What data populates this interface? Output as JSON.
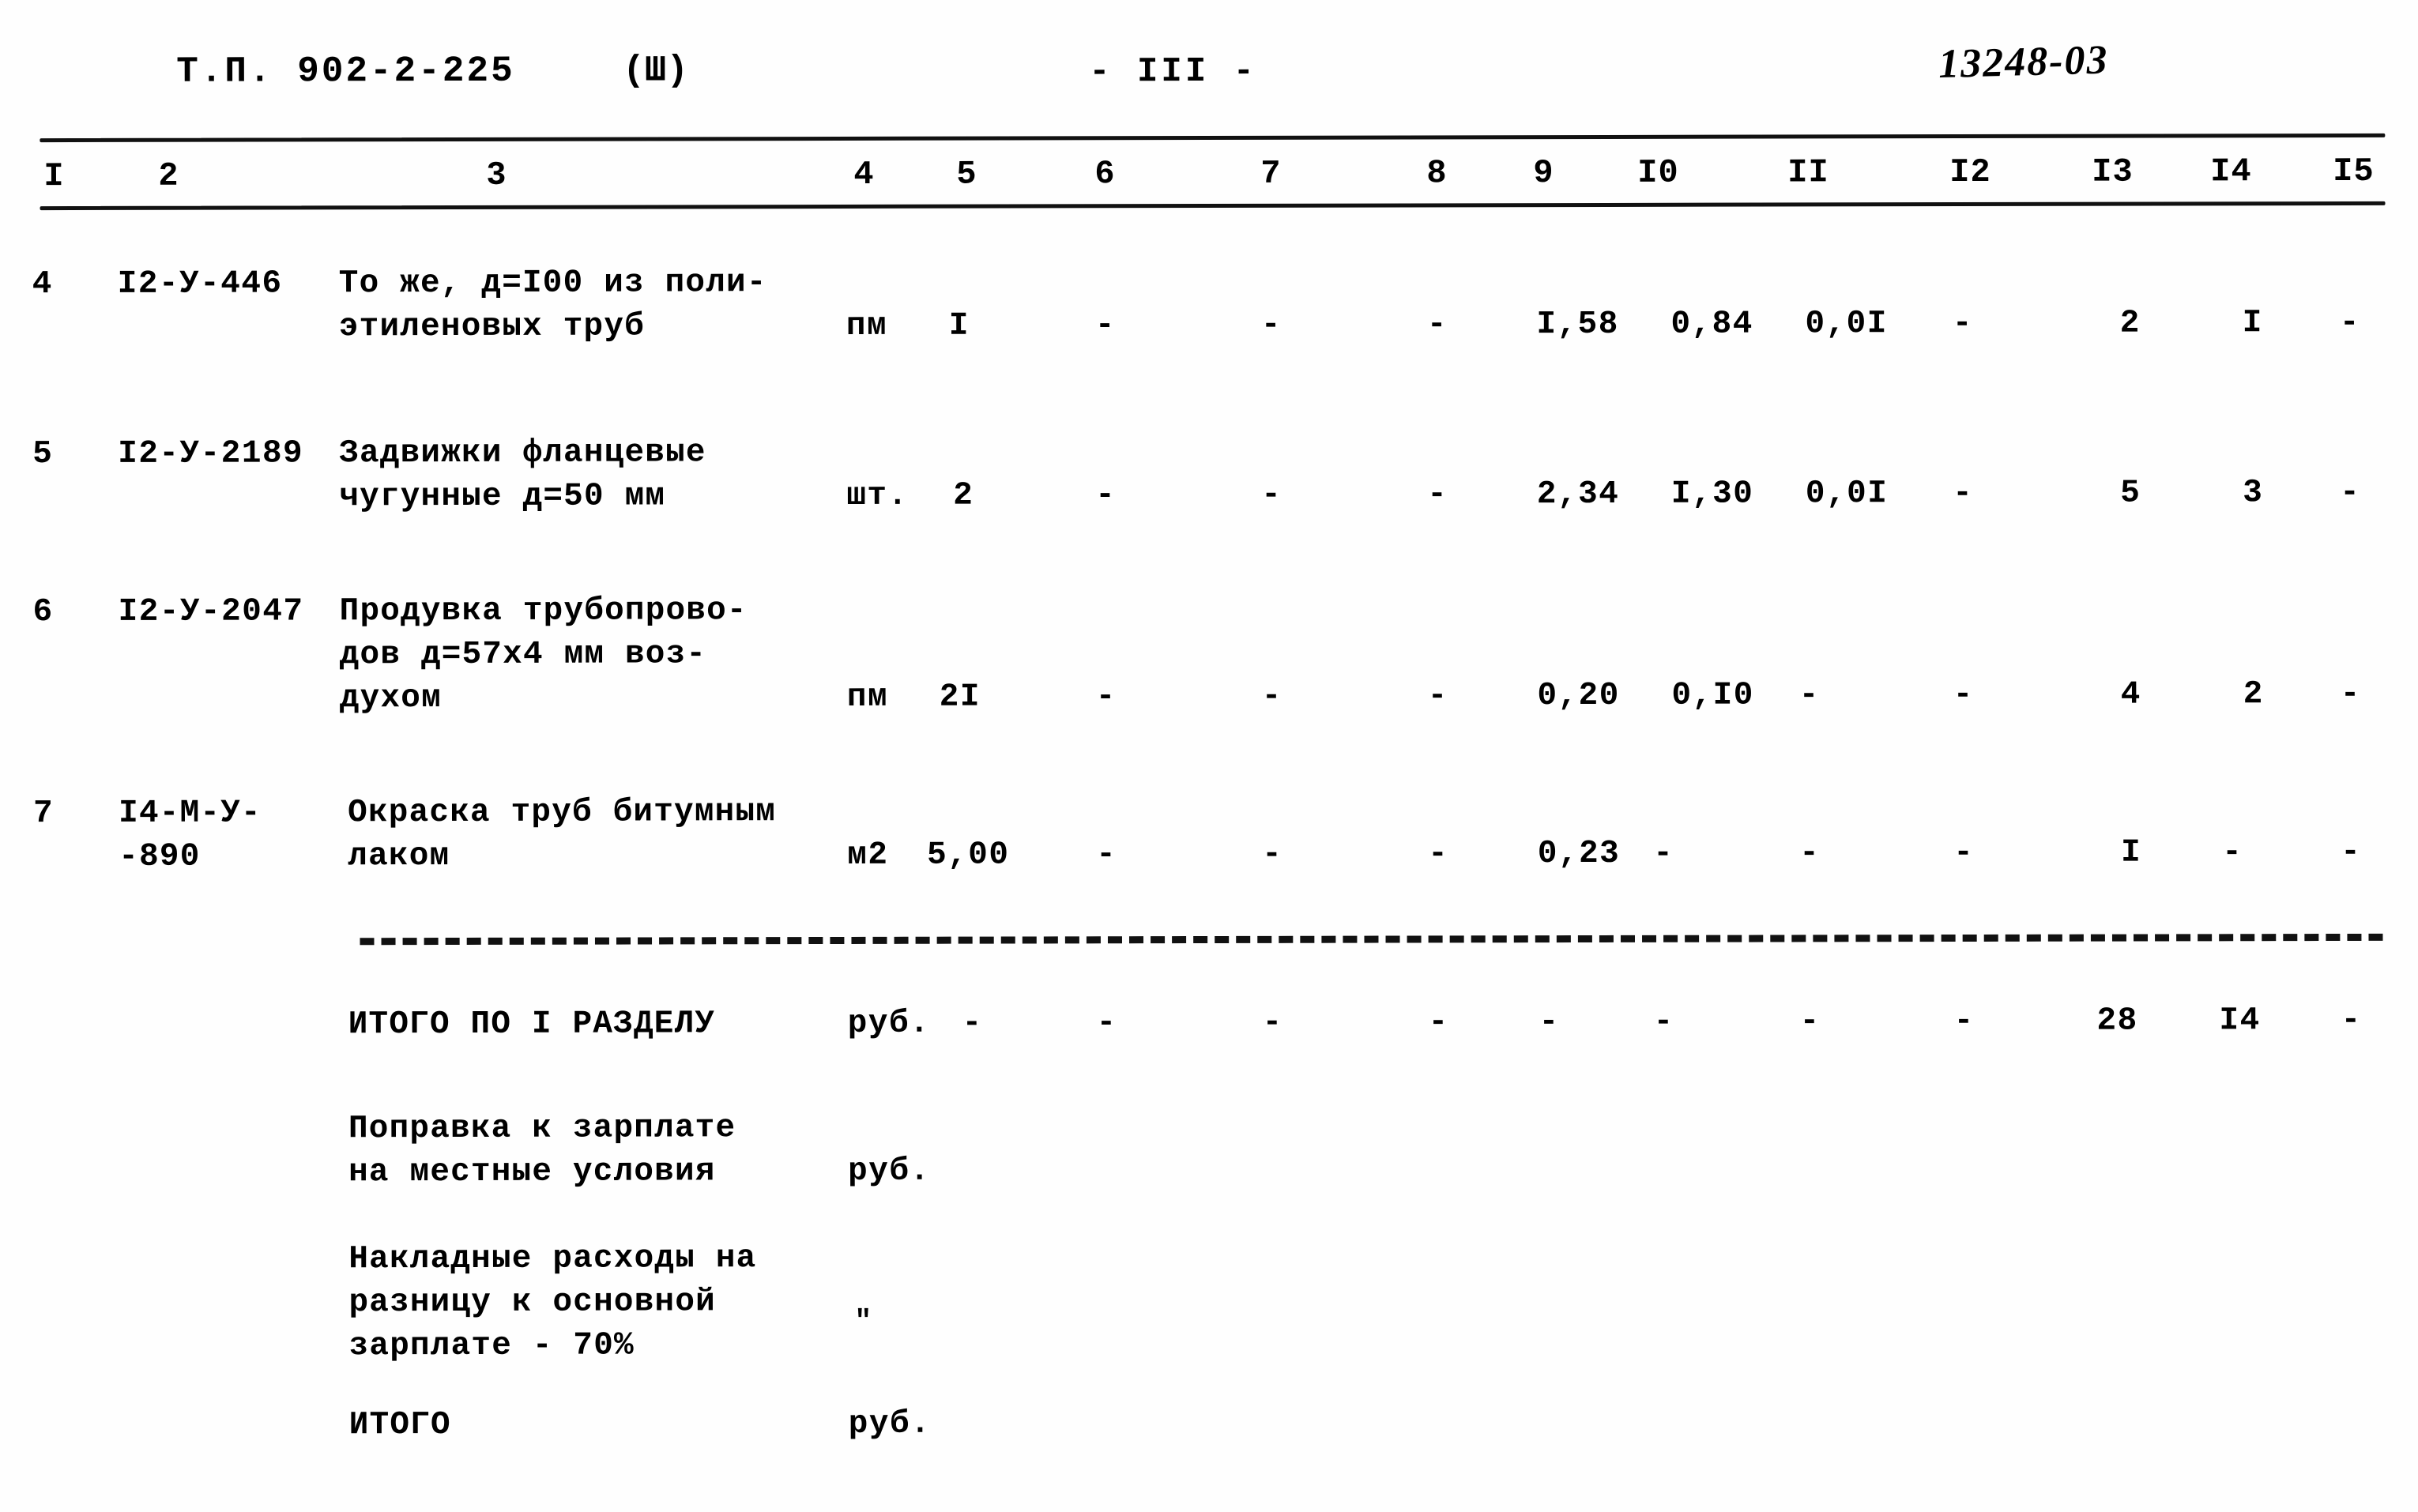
{
  "header": {
    "document_code": "Т.П. 902-2-225",
    "variant": "(Ш)",
    "page_label": "- III -",
    "stamp_number": "13248-03"
  },
  "table": {
    "column_numbers": [
      "I",
      "2",
      "3",
      "4",
      "5",
      "6",
      "7",
      "8",
      "9",
      "I0",
      "II",
      "I2",
      "I3",
      "I4",
      "I5"
    ],
    "rows": [
      {
        "no": "4",
        "code": "I2-У-446",
        "description": "То же, д=I00 из поли-\nэтиленовых труб",
        "unit": "пм",
        "qty": "I",
        "c6": "-",
        "c7": "-",
        "c8": "-",
        "c9": "I,58",
        "c10": "0,84",
        "c11": "0,0I",
        "c12": "-",
        "c13": "2",
        "c14": "I",
        "c15": "-"
      },
      {
        "no": "5",
        "code": "I2-У-2189",
        "description": "Задвижки фланцевые\nчугунные д=50 мм",
        "unit": "шт.",
        "qty": "2",
        "c6": "-",
        "c7": "-",
        "c8": "-",
        "c9": "2,34",
        "c10": "I,30",
        "c11": "0,0I",
        "c12": "-",
        "c13": "5",
        "c14": "3",
        "c15": "-"
      },
      {
        "no": "6",
        "code": "I2-У-2047",
        "description": "Продувка трубопрово-\nдов д=57х4 мм воз-\nдухом",
        "unit": "пм",
        "qty": "2I",
        "c6": "-",
        "c7": "-",
        "c8": "-",
        "c9": "0,20",
        "c10": "0,I0",
        "c11": "-",
        "c12": "-",
        "c13": "4",
        "c14": "2",
        "c15": "-"
      },
      {
        "no": "7",
        "code": "I4-М-У-\n-890",
        "description": "Окраска труб битумным\nлаком",
        "unit": "м2",
        "qty": "5,00",
        "c6": "-",
        "c7": "-",
        "c8": "-",
        "c9": "0,23",
        "c10": "-",
        "c11": "-",
        "c12": "-",
        "c13": "I",
        "c14": "-",
        "c15": "-"
      }
    ],
    "summary_rows": [
      {
        "label": "ИТОГО ПО I РАЗДЕЛУ",
        "unit": "руб.",
        "qty": "-",
        "c6": "-",
        "c7": "-",
        "c8": "-",
        "c9": "-",
        "c10": "-",
        "c11": "-",
        "c12": "-",
        "c13": "28",
        "c14": "I4",
        "c15": "-"
      },
      {
        "label": "Поправка к зарплате\nна местные условия",
        "unit": "руб.",
        "qty": "",
        "c6": "",
        "c7": "",
        "c8": "",
        "c9": "",
        "c10": "",
        "c11": "",
        "c12": "",
        "c13": "",
        "c14": "",
        "c15": ""
      },
      {
        "label": "Накладные расходы на\nразницу к основной\nзарплате - 70%",
        "unit": "\"",
        "qty": "",
        "c6": "",
        "c7": "",
        "c8": "",
        "c9": "",
        "c10": "",
        "c11": "",
        "c12": "",
        "c13": "",
        "c14": "",
        "c15": ""
      },
      {
        "label": "ИТОГО",
        "unit": "руб.",
        "qty": "",
        "c6": "",
        "c7": "",
        "c8": "",
        "c9": "",
        "c10": "",
        "c11": "",
        "c12": "",
        "c13": "",
        "c14": "",
        "c15": ""
      }
    ]
  },
  "colors": {
    "ink": "#111111",
    "paper": "#fefefe"
  }
}
